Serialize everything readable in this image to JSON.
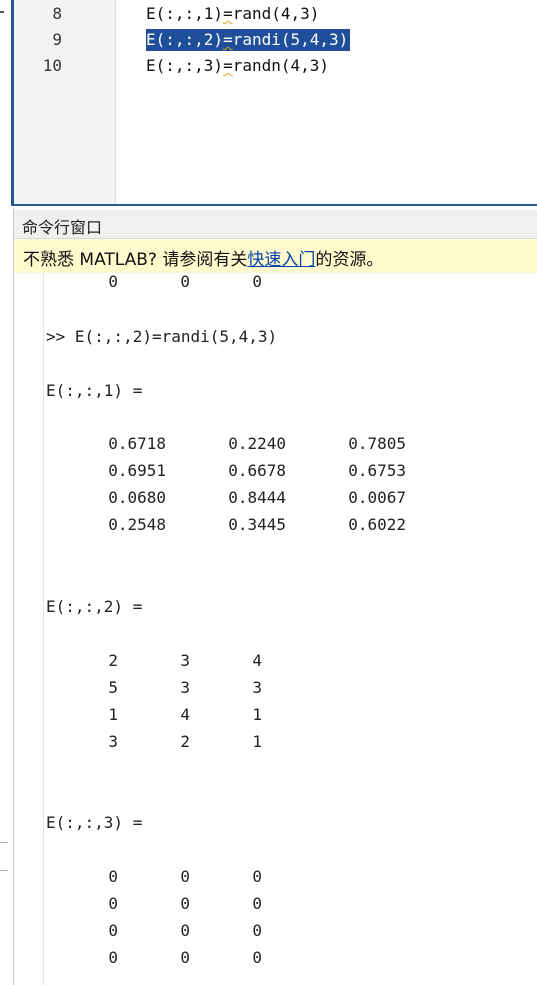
{
  "editor": {
    "lines": [
      {
        "num": "8",
        "code_before": "E(:,:,1)",
        "eq": "=",
        "code_after": "rand(4,3)",
        "selected": false
      },
      {
        "num": "9",
        "code_before": "E(:,:,2)",
        "eq": "=",
        "code_after": "randi(5,4,3)",
        "selected": true
      },
      {
        "num": "10",
        "code_before": "E(:,:,3)",
        "eq": "=",
        "code_after": "randn(4,3)",
        "selected": false
      }
    ]
  },
  "command_window": {
    "title": "命令行窗口",
    "banner": {
      "prefix": "不熟悉 MATLAB? 请参阅有关",
      "link": "快速入门",
      "suffix": "的资源。"
    },
    "top_row": [
      "0",
      "0",
      "0"
    ],
    "prompt": ">> E(:,:,2)=randi(5,4,3)",
    "page1": {
      "header": "E(:,:,1) =",
      "rows": [
        [
          "0.6718",
          "0.2240",
          "0.7805"
        ],
        [
          "0.6951",
          "0.6678",
          "0.6753"
        ],
        [
          "0.0680",
          "0.8444",
          "0.0067"
        ],
        [
          "0.2548",
          "0.3445",
          "0.6022"
        ]
      ]
    },
    "page2": {
      "header": "E(:,:,2) =",
      "rows": [
        [
          "2",
          "3",
          "4"
        ],
        [
          "5",
          "3",
          "3"
        ],
        [
          "1",
          "4",
          "1"
        ],
        [
          "3",
          "2",
          "1"
        ]
      ]
    },
    "page3": {
      "header": "E(:,:,3) =",
      "rows": [
        [
          "0",
          "0",
          "0"
        ],
        [
          "0",
          "0",
          "0"
        ],
        [
          "0",
          "0",
          "0"
        ],
        [
          "0",
          "0",
          "0"
        ]
      ]
    }
  },
  "colors": {
    "selection": "#1f4e9a",
    "banner_bg": "#fffacd",
    "link": "#0645ad",
    "warning_underline": "#d9a321"
  }
}
